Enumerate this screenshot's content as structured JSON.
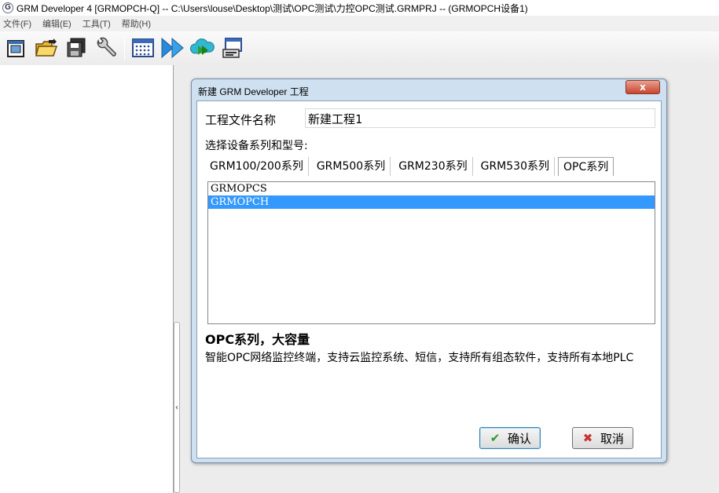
{
  "window": {
    "title": "GRM Developer 4 [GRMOPCH-Q]  -- C:\\Users\\louse\\Desktop\\测试\\OPC测试\\力控OPC测试.GRMPRJ -- (GRMOPCH设备1)",
    "app_icon_letter": "G"
  },
  "menu": [
    "文件(F)",
    "编辑(E)",
    "工具(T)",
    "帮助(H)"
  ],
  "toolbar": {
    "buttons": [
      {
        "icon": "new-project-icon"
      },
      {
        "icon": "open-folder-icon"
      },
      {
        "icon": "save-icon"
      },
      {
        "icon": "settings-wrench-icon"
      },
      {
        "icon": "compile-grid-icon"
      },
      {
        "icon": "download-arrows-icon"
      },
      {
        "icon": "cloud-download-icon"
      },
      {
        "icon": "device-monitor-icon"
      }
    ]
  },
  "dialog": {
    "title": "新建 GRM Developer 工程",
    "close_label": "x",
    "project_name_label": "工程文件名称",
    "project_name_value": "新建工程1",
    "select_label": "选择设备系列和型号:",
    "tabs": [
      {
        "label": "GRM100/200系列",
        "active": false
      },
      {
        "label": "GRM500系列",
        "active": false
      },
      {
        "label": "GRM230系列",
        "active": false
      },
      {
        "label": "GRM530系列",
        "active": false
      },
      {
        "label": "OPC系列",
        "active": true
      }
    ],
    "models": [
      {
        "label": "GRMOPCS",
        "selected": false
      },
      {
        "label": "GRMOPCH",
        "selected": true
      }
    ],
    "description_title": "OPC系列，大容量",
    "description_text": "智能OPC网络监控终端，支持云监控系统、短信，支持所有组态软件，支持所有本地PLC",
    "ok_label": "确认",
    "cancel_label": "取消"
  },
  "splitter_glyph": "‹",
  "colors": {
    "selection": "#3399ff",
    "dialog_frame": "#cfe0f0",
    "close_button": "#c8452e"
  }
}
